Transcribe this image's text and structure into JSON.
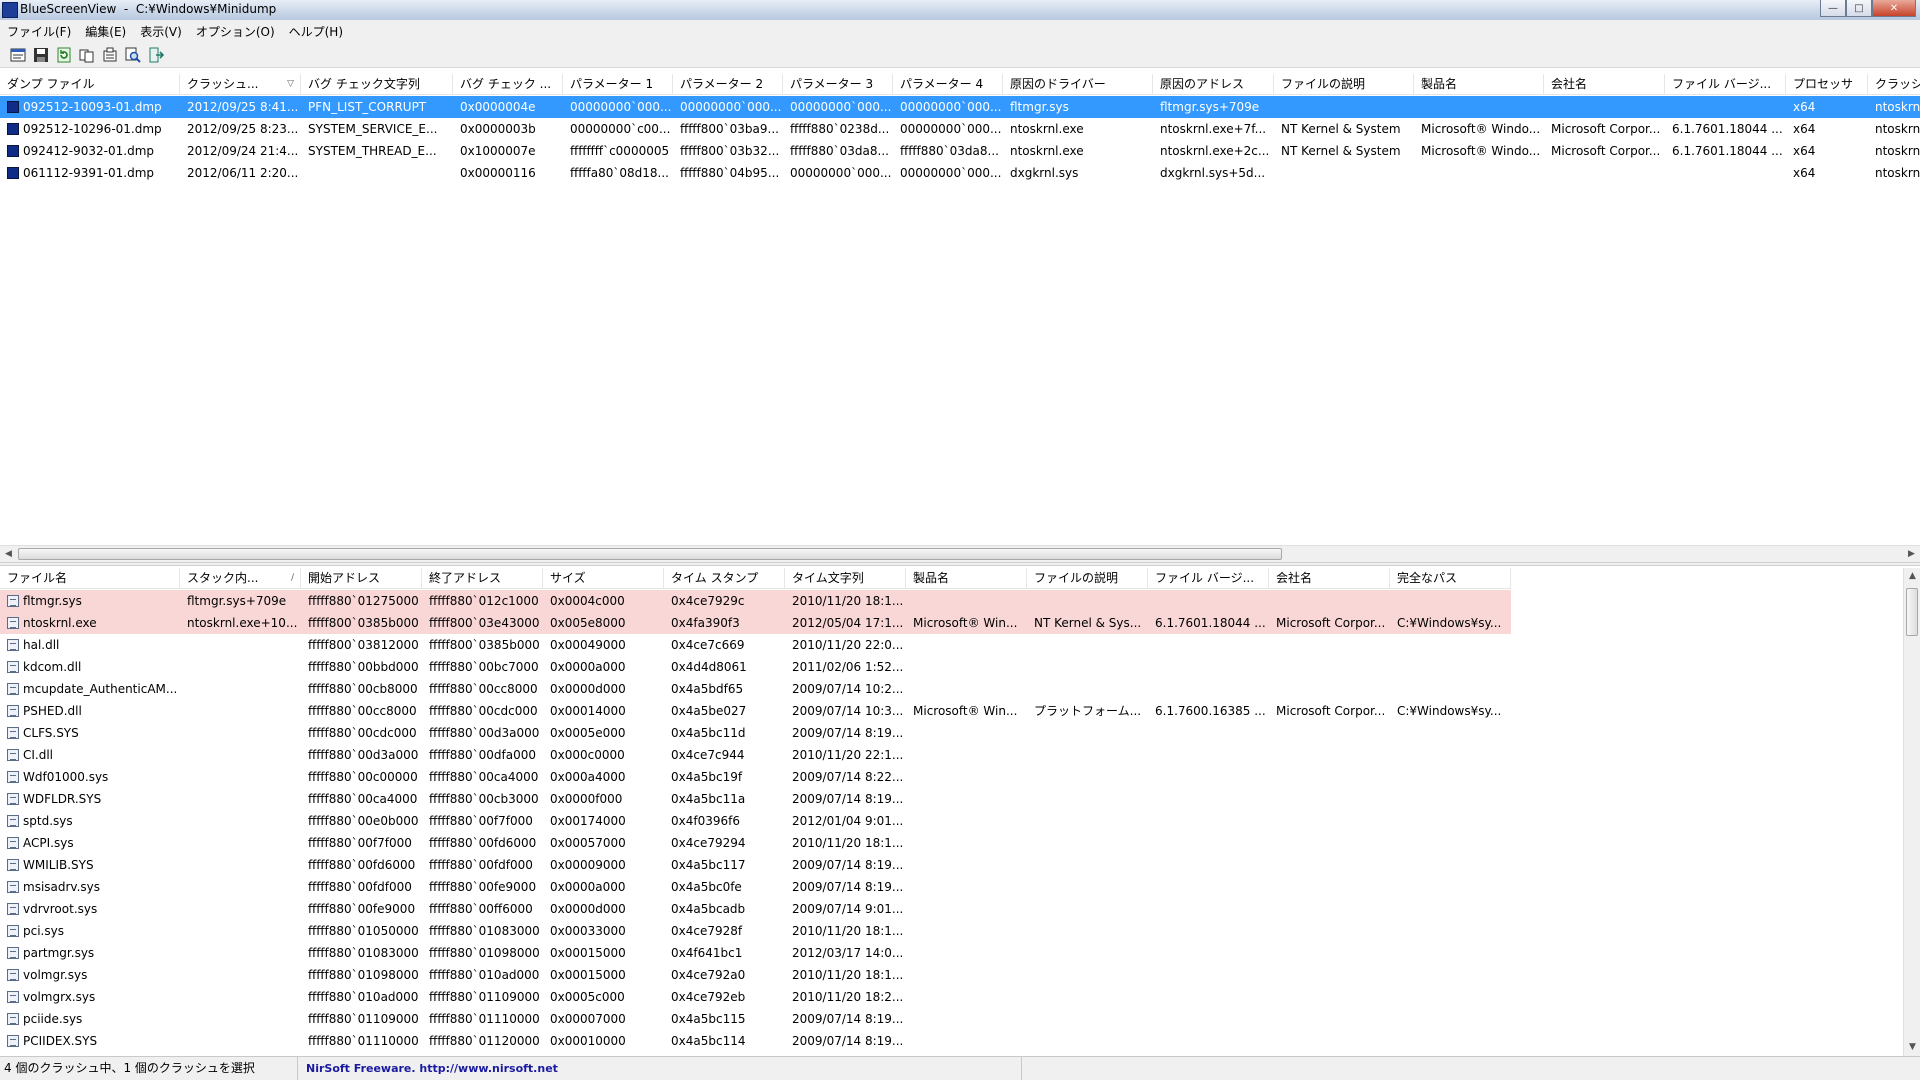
{
  "window": {
    "title": "BlueScreenView  -  C:¥Windows¥Minidump"
  },
  "menu": [
    "ファイル(F)",
    "編集(E)",
    "表示(V)",
    "オプション(O)",
    "ヘルプ(H)"
  ],
  "toolbar": [
    "properties-icon",
    "save-icon",
    "refresh-icon",
    "copy-icon",
    "options-icon",
    "find-icon",
    "exit-icon"
  ],
  "crash_list": {
    "columns": [
      "ダンプ ファイル",
      "クラッシュ...",
      "バグ チェック文字列",
      "バグ チェック ...",
      "パラメーター 1",
      "パラメーター 2",
      "パラメーター 3",
      "パラメーター 4",
      "原因のドライバー",
      "原因のアドレス",
      "ファイルの説明",
      "製品名",
      "会社名",
      "ファイル バージ...",
      "プロセッサ",
      "クラッシュ..."
    ],
    "sort_indicator": "▽",
    "rows": [
      [
        "092512-10093-01.dmp",
        "2012/09/25 8:41...",
        "PFN_LIST_CORRUPT",
        "0x0000004e",
        "00000000`000...",
        "00000000`000...",
        "00000000`000...",
        "00000000`000...",
        "fltmgr.sys",
        "fltmgr.sys+709e",
        "",
        "",
        "",
        "",
        "x64",
        "ntoskrnl..."
      ],
      [
        "092512-10296-01.dmp",
        "2012/09/25 8:23...",
        "SYSTEM_SERVICE_E...",
        "0x0000003b",
        "00000000`c00...",
        "fffff800`03ba9...",
        "fffff880`0238d...",
        "00000000`000...",
        "ntoskrnl.exe",
        "ntoskrnl.exe+7f...",
        "NT Kernel & System",
        "Microsoft® Windo...",
        "Microsoft Corpor...",
        "6.1.7601.18044 ...",
        "x64",
        "ntoskrnl..."
      ],
      [
        "092412-9032-01.dmp",
        "2012/09/24 21:4...",
        "SYSTEM_THREAD_E...",
        "0x1000007e",
        "ffffffff`c0000005",
        "fffff800`03b32...",
        "fffff880`03da8...",
        "fffff880`03da8...",
        "ntoskrnl.exe",
        "ntoskrnl.exe+2c...",
        "NT Kernel & System",
        "Microsoft® Windo...",
        "Microsoft Corpor...",
        "6.1.7601.18044 ...",
        "x64",
        "ntoskrnl..."
      ],
      [
        "061112-9391-01.dmp",
        "2012/06/11 2:20...",
        "",
        "0x00000116",
        "fffffa80`08d18...",
        "fffff880`04b95...",
        "00000000`000...",
        "00000000`000...",
        "dxgkrnl.sys",
        "dxgkrnl.sys+5d...",
        "",
        "",
        "",
        "",
        "x64",
        "ntoskrnl..."
      ]
    ]
  },
  "driver_list": {
    "columns": [
      "ファイル名",
      "スタック内...",
      "開始アドレス",
      "終了アドレス",
      "サイズ",
      "タイム スタンプ",
      "タイム文字列",
      "製品名",
      "ファイルの説明",
      "ファイル バージ...",
      "会社名",
      "完全なパス"
    ],
    "sort_indicator": "/",
    "rows": [
      [
        "fltmgr.sys",
        "fltmgr.sys+709e",
        "fffff880`01275000",
        "fffff880`012c1000",
        "0x0004c000",
        "0x4ce7929c",
        "2010/11/20 18:1...",
        "",
        "",
        "",
        "",
        ""
      ],
      [
        "ntoskrnl.exe",
        "ntoskrnl.exe+10...",
        "fffff800`0385b000",
        "fffff800`03e43000",
        "0x005e8000",
        "0x4fa390f3",
        "2012/05/04 17:1...",
        "Microsoft® Win...",
        "NT Kernel & Sys...",
        "6.1.7601.18044 ...",
        "Microsoft Corpor...",
        "C:¥Windows¥sy..."
      ],
      [
        "hal.dll",
        "",
        "fffff800`03812000",
        "fffff800`0385b000",
        "0x00049000",
        "0x4ce7c669",
        "2010/11/20 22:0...",
        "",
        "",
        "",
        "",
        ""
      ],
      [
        "kdcom.dll",
        "",
        "fffff880`00bbd000",
        "fffff880`00bc7000",
        "0x0000a000",
        "0x4d4d8061",
        "2011/02/06 1:52...",
        "",
        "",
        "",
        "",
        ""
      ],
      [
        "mcupdate_AuthenticAM...",
        "",
        "fffff880`00cb8000",
        "fffff880`00cc8000",
        "0x0000d000",
        "0x4a5bdf65",
        "2009/07/14 10:2...",
        "",
        "",
        "",
        "",
        ""
      ],
      [
        "PSHED.dll",
        "",
        "fffff880`00cc8000",
        "fffff880`00cdc000",
        "0x00014000",
        "0x4a5be027",
        "2009/07/14 10:3...",
        "Microsoft® Win...",
        "プラットフォーム...",
        "6.1.7600.16385 ...",
        "Microsoft Corpor...",
        "C:¥Windows¥sy..."
      ],
      [
        "CLFS.SYS",
        "",
        "fffff880`00cdc000",
        "fffff880`00d3a000",
        "0x0005e000",
        "0x4a5bc11d",
        "2009/07/14 8:19...",
        "",
        "",
        "",
        "",
        ""
      ],
      [
        "CI.dll",
        "",
        "fffff880`00d3a000",
        "fffff880`00dfa000",
        "0x000c0000",
        "0x4ce7c944",
        "2010/11/20 22:1...",
        "",
        "",
        "",
        "",
        ""
      ],
      [
        "Wdf01000.sys",
        "",
        "fffff880`00c00000",
        "fffff880`00ca4000",
        "0x000a4000",
        "0x4a5bc19f",
        "2009/07/14 8:22...",
        "",
        "",
        "",
        "",
        ""
      ],
      [
        "WDFLDR.SYS",
        "",
        "fffff880`00ca4000",
        "fffff880`00cb3000",
        "0x0000f000",
        "0x4a5bc11a",
        "2009/07/14 8:19...",
        "",
        "",
        "",
        "",
        ""
      ],
      [
        "sptd.sys",
        "",
        "fffff880`00e0b000",
        "fffff880`00f7f000",
        "0x00174000",
        "0x4f0396f6",
        "2012/01/04 9:01...",
        "",
        "",
        "",
        "",
        ""
      ],
      [
        "ACPI.sys",
        "",
        "fffff880`00f7f000",
        "fffff880`00fd6000",
        "0x00057000",
        "0x4ce79294",
        "2010/11/20 18:1...",
        "",
        "",
        "",
        "",
        ""
      ],
      [
        "WMILIB.SYS",
        "",
        "fffff880`00fd6000",
        "fffff880`00fdf000",
        "0x00009000",
        "0x4a5bc117",
        "2009/07/14 8:19...",
        "",
        "",
        "",
        "",
        ""
      ],
      [
        "msisadrv.sys",
        "",
        "fffff880`00fdf000",
        "fffff880`00fe9000",
        "0x0000a000",
        "0x4a5bc0fe",
        "2009/07/14 8:19...",
        "",
        "",
        "",
        "",
        ""
      ],
      [
        "vdrvroot.sys",
        "",
        "fffff880`00fe9000",
        "fffff880`00ff6000",
        "0x0000d000",
        "0x4a5bcadb",
        "2009/07/14 9:01...",
        "",
        "",
        "",
        "",
        ""
      ],
      [
        "pci.sys",
        "",
        "fffff880`01050000",
        "fffff880`01083000",
        "0x00033000",
        "0x4ce7928f",
        "2010/11/20 18:1...",
        "",
        "",
        "",
        "",
        ""
      ],
      [
        "partmgr.sys",
        "",
        "fffff880`01083000",
        "fffff880`01098000",
        "0x00015000",
        "0x4f641bc1",
        "2012/03/17 14:0...",
        "",
        "",
        "",
        "",
        ""
      ],
      [
        "volmgr.sys",
        "",
        "fffff880`01098000",
        "fffff880`010ad000",
        "0x00015000",
        "0x4ce792a0",
        "2010/11/20 18:1...",
        "",
        "",
        "",
        "",
        ""
      ],
      [
        "volmgrx.sys",
        "",
        "fffff880`010ad000",
        "fffff880`01109000",
        "0x0005c000",
        "0x4ce792eb",
        "2010/11/20 18:2...",
        "",
        "",
        "",
        "",
        ""
      ],
      [
        "pciide.sys",
        "",
        "fffff880`01109000",
        "fffff880`01110000",
        "0x00007000",
        "0x4a5bc115",
        "2009/07/14 8:19...",
        "",
        "",
        "",
        "",
        ""
      ],
      [
        "PCIIDEX.SYS",
        "",
        "fffff880`01110000",
        "fffff880`01120000",
        "0x00010000",
        "0x4a5bc114",
        "2009/07/14 8:19...",
        "",
        "",
        "",
        "",
        ""
      ]
    ]
  },
  "status": {
    "summary": "4 個のクラッシュ中、1 個のクラッシュを選択",
    "credit": "NirSoft Freeware.  http://www.nirsoft.net"
  },
  "colors": {
    "selection": "#3399ff",
    "highlight": "#f9d7d7"
  }
}
